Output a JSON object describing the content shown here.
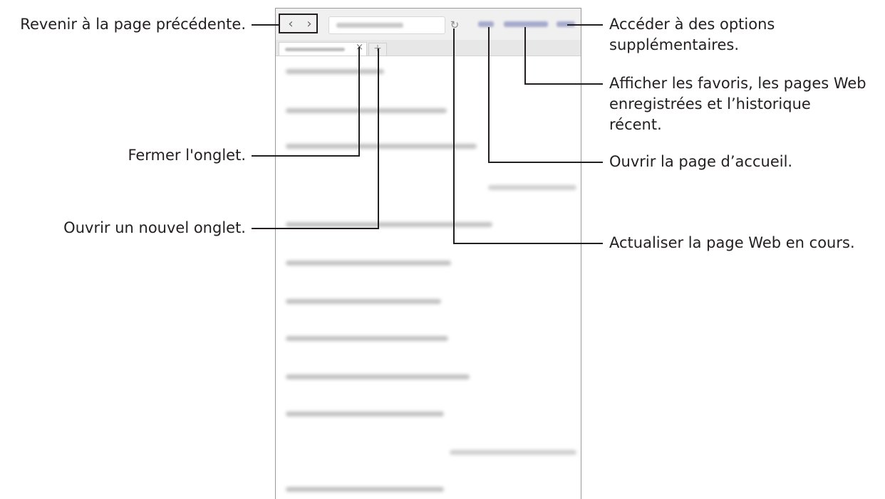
{
  "callouts": {
    "back_forward": "Revenir à la page précédente.",
    "close_tab": "Fermer l'onglet.",
    "new_tab": "Ouvrir un nouvel onglet.",
    "more_options_line1": "Accéder à des options",
    "more_options_line2": "supplémentaires.",
    "bookmarks_line1": "Afficher les favoris, les pages Web",
    "bookmarks_line2": "enregistrées et l’historique",
    "bookmarks_line3": "récent.",
    "home": "Ouvrir la page d’accueil.",
    "refresh": "Actualiser la page Web en cours."
  },
  "browser": {
    "back_icon": "‹",
    "forward_icon": "›",
    "refresh_icon": "↻",
    "close_tab_icon": "×",
    "new_tab_icon": "+"
  },
  "icons": {
    "back": "chevron-left-icon",
    "forward": "chevron-right-icon",
    "refresh": "refresh-icon",
    "close": "close-icon",
    "add": "plus-icon"
  },
  "colors": {
    "text": "#231f20",
    "frame": "#9a9a9a",
    "toolbar": "#f0f0f0",
    "link_blur": "#a6aacc",
    "content_blur": "#c2c2c2"
  }
}
